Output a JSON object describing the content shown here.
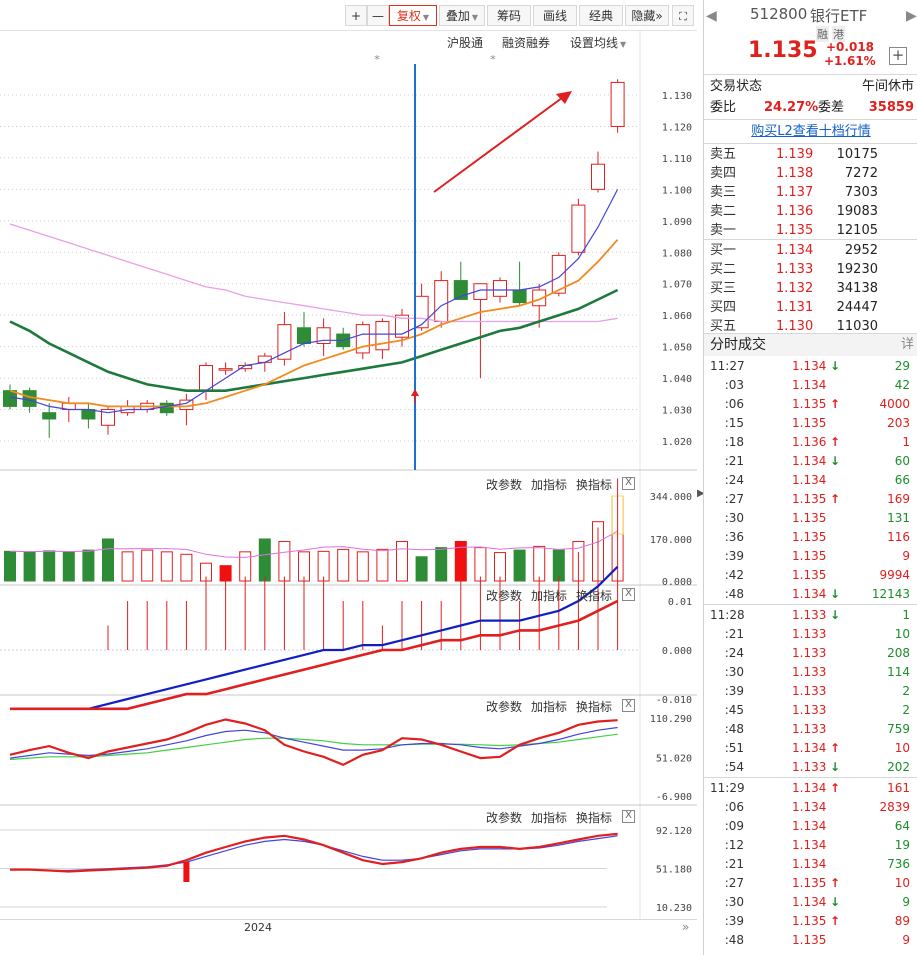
{
  "toolbar": {
    "plus": "+",
    "minus": "—",
    "fuquan": "复权",
    "diejia": "叠加",
    "chouma": "筹码",
    "huaxian": "画线",
    "jingdian": "经典",
    "yincang": "隐藏",
    "more": "»",
    "expand": "⛶"
  },
  "sublinks": {
    "hugutong": "沪股通",
    "rongzi": "融资融券",
    "setma": "设置均线"
  },
  "price_axis": [
    "1.130",
    "1.120",
    "1.110",
    "1.100",
    "1.090",
    "1.080",
    "1.070",
    "1.060",
    "1.050",
    "1.040",
    "1.030",
    "1.020"
  ],
  "vol_axis": [
    "344.000",
    "170.000",
    "0.000"
  ],
  "macd_axis": [
    "0.01",
    "0.000",
    "-0.010"
  ],
  "ind3_axis": [
    "110.290",
    "51.020",
    "-6.900"
  ],
  "ind4_axis": [
    "92.120",
    "51.180",
    "10.230"
  ],
  "panel_controls": {
    "gai": "改参数",
    "jia": "加指标",
    "huan": "换指标",
    "close": "X"
  },
  "date_label": "2024",
  "scroll_more": "»",
  "colors": {
    "up": "#e0201e",
    "down": "#2e8b36",
    "ma5": "#4444dd",
    "ma10": "#f28a1e",
    "ma20": "#1e7a3c",
    "ma60": "#e8a0e8",
    "cursor": "#1d6fd1"
  },
  "chart_data": {
    "type": "candlestick",
    "ylim": [
      1.013,
      1.138
    ],
    "candles": [
      {
        "o": 1.036,
        "h": 1.038,
        "l": 1.03,
        "c": 1.031
      },
      {
        "o": 1.036,
        "h": 1.037,
        "l": 1.029,
        "c": 1.031
      },
      {
        "o": 1.029,
        "h": 1.032,
        "l": 1.021,
        "c": 1.027
      },
      {
        "o": 1.03,
        "h": 1.034,
        "l": 1.026,
        "c": 1.032
      },
      {
        "o": 1.03,
        "h": 1.032,
        "l": 1.024,
        "c": 1.027
      },
      {
        "o": 1.025,
        "h": 1.031,
        "l": 1.022,
        "c": 1.03
      },
      {
        "o": 1.029,
        "h": 1.033,
        "l": 1.028,
        "c": 1.031
      },
      {
        "o": 1.03,
        "h": 1.033,
        "l": 1.029,
        "c": 1.032
      },
      {
        "o": 1.032,
        "h": 1.033,
        "l": 1.028,
        "c": 1.029
      },
      {
        "o": 1.03,
        "h": 1.035,
        "l": 1.025,
        "c": 1.033
      },
      {
        "o": 1.036,
        "h": 1.045,
        "l": 1.033,
        "c": 1.044
      },
      {
        "o": 1.043,
        "h": 1.045,
        "l": 1.041,
        "c": 1.043
      },
      {
        "o": 1.043,
        "h": 1.045,
        "l": 1.042,
        "c": 1.044
      },
      {
        "o": 1.045,
        "h": 1.048,
        "l": 1.042,
        "c": 1.047
      },
      {
        "o": 1.046,
        "h": 1.061,
        "l": 1.044,
        "c": 1.057
      },
      {
        "o": 1.056,
        "h": 1.061,
        "l": 1.05,
        "c": 1.051
      },
      {
        "o": 1.051,
        "h": 1.059,
        "l": 1.047,
        "c": 1.056
      },
      {
        "o": 1.054,
        "h": 1.056,
        "l": 1.049,
        "c": 1.05
      },
      {
        "o": 1.048,
        "h": 1.058,
        "l": 1.046,
        "c": 1.057
      },
      {
        "o": 1.049,
        "h": 1.059,
        "l": 1.046,
        "c": 1.058
      },
      {
        "o": 1.053,
        "h": 1.062,
        "l": 1.05,
        "c": 1.06
      },
      {
        "o": 1.056,
        "h": 1.07,
        "l": 1.055,
        "c": 1.066
      },
      {
        "o": 1.058,
        "h": 1.074,
        "l": 1.056,
        "c": 1.071
      },
      {
        "o": 1.071,
        "h": 1.077,
        "l": 1.066,
        "c": 1.065
      },
      {
        "o": 1.065,
        "h": 1.07,
        "l": 1.04,
        "c": 1.07
      },
      {
        "o": 1.066,
        "h": 1.072,
        "l": 1.064,
        "c": 1.071
      },
      {
        "o": 1.068,
        "h": 1.077,
        "l": 1.063,
        "c": 1.064
      },
      {
        "o": 1.063,
        "h": 1.07,
        "l": 1.056,
        "c": 1.068
      },
      {
        "o": 1.067,
        "h": 1.08,
        "l": 1.066,
        "c": 1.079
      },
      {
        "o": 1.08,
        "h": 1.097,
        "l": 1.079,
        "c": 1.095
      },
      {
        "o": 1.1,
        "h": 1.112,
        "l": 1.099,
        "c": 1.108
      },
      {
        "o": 1.12,
        "h": 1.135,
        "l": 1.118,
        "c": 1.134
      }
    ],
    "ma5": [
      1.034,
      1.033,
      1.031,
      1.03,
      1.03,
      1.029,
      1.03,
      1.03,
      1.031,
      1.032,
      1.036,
      1.04,
      1.044,
      1.045,
      1.048,
      1.051,
      1.052,
      1.052,
      1.054,
      1.054,
      1.054,
      1.057,
      1.063,
      1.066,
      1.068,
      1.068,
      1.068,
      1.069,
      1.072,
      1.078,
      1.088,
      1.1
    ],
    "ma10": [
      1.036,
      1.034,
      1.033,
      1.032,
      1.032,
      1.031,
      1.031,
      1.031,
      1.031,
      1.031,
      1.032,
      1.034,
      1.036,
      1.038,
      1.041,
      1.044,
      1.046,
      1.048,
      1.05,
      1.051,
      1.052,
      1.054,
      1.057,
      1.059,
      1.061,
      1.062,
      1.063,
      1.065,
      1.068,
      1.071,
      1.077,
      1.084
    ],
    "ma20": [
      1.058,
      1.055,
      1.051,
      1.048,
      1.045,
      1.042,
      1.04,
      1.038,
      1.037,
      1.036,
      1.036,
      1.036,
      1.037,
      1.038,
      1.039,
      1.04,
      1.041,
      1.042,
      1.043,
      1.044,
      1.045,
      1.047,
      1.049,
      1.051,
      1.053,
      1.055,
      1.056,
      1.058,
      1.06,
      1.062,
      1.065,
      1.068
    ],
    "ma60": [
      1.089,
      1.087,
      1.085,
      1.083,
      1.081,
      1.079,
      1.077,
      1.075,
      1.073,
      1.071,
      1.069,
      1.068,
      1.066,
      1.065,
      1.064,
      1.063,
      1.062,
      1.061,
      1.06,
      1.06,
      1.059,
      1.059,
      1.058,
      1.058,
      1.058,
      1.058,
      1.058,
      1.058,
      1.058,
      1.058,
      1.058,
      1.059
    ],
    "volume": [
      120,
      118,
      122,
      118,
      125,
      170,
      118,
      125,
      118,
      108,
      72,
      62,
      118,
      170,
      160,
      118,
      120,
      128,
      118,
      128,
      160,
      98,
      135,
      160,
      135,
      115,
      125,
      140,
      125,
      160,
      240,
      344
    ],
    "volume_up_flags": [
      0,
      0,
      0,
      0,
      0,
      0,
      1,
      1,
      1,
      1,
      1,
      2,
      1,
      0,
      1,
      1,
      1,
      1,
      1,
      1,
      1,
      0,
      0,
      2,
      1,
      1,
      0,
      1,
      0,
      1,
      1,
      1
    ],
    "macd_dif": [
      -0.012,
      -0.012,
      -0.012,
      -0.012,
      -0.012,
      -0.011,
      -0.01,
      -0.009,
      -0.008,
      -0.007,
      -0.006,
      -0.005,
      -0.004,
      -0.003,
      -0.002,
      -0.001,
      0.0,
      0.0,
      0.001,
      0.001,
      0.002,
      0.003,
      0.004,
      0.005,
      0.006,
      0.006,
      0.006,
      0.007,
      0.008,
      0.01,
      0.013,
      0.017
    ],
    "macd_dea": [
      -0.012,
      -0.012,
      -0.012,
      -0.012,
      -0.012,
      -0.012,
      -0.012,
      -0.011,
      -0.01,
      -0.009,
      -0.009,
      -0.008,
      -0.007,
      -0.006,
      -0.005,
      -0.004,
      -0.003,
      -0.002,
      -0.001,
      0.0,
      0.0,
      0.001,
      0.002,
      0.002,
      0.003,
      0.003,
      0.004,
      0.004,
      0.005,
      0.006,
      0.008,
      0.01
    ],
    "ind3_a": [
      55,
      62,
      68,
      58,
      50,
      60,
      66,
      72,
      78,
      88,
      100,
      108,
      102,
      92,
      70,
      60,
      52,
      40,
      55,
      62,
      80,
      78,
      70,
      60,
      50,
      52,
      70,
      80,
      88,
      100,
      105,
      107
    ],
    "ind3_b": [
      50,
      54,
      58,
      56,
      54,
      56,
      60,
      64,
      70,
      76,
      84,
      90,
      92,
      88,
      80,
      74,
      68,
      62,
      62,
      64,
      70,
      72,
      72,
      70,
      66,
      64,
      68,
      72,
      78,
      86,
      92,
      96
    ],
    "ind3_c": [
      48,
      50,
      52,
      52,
      52,
      54,
      56,
      58,
      62,
      66,
      70,
      74,
      78,
      80,
      80,
      78,
      76,
      72,
      70,
      70,
      70,
      71,
      71,
      71,
      70,
      69,
      70,
      72,
      74,
      78,
      82,
      86
    ],
    "ind4_a": [
      50,
      50,
      49,
      48,
      49,
      50,
      51,
      52,
      54,
      60,
      68,
      74,
      80,
      84,
      86,
      82,
      76,
      68,
      60,
      56,
      58,
      62,
      68,
      72,
      74,
      74,
      72,
      74,
      78,
      82,
      86,
      88
    ],
    "ind4_b": [
      50,
      50,
      49,
      49,
      50,
      51,
      52,
      53,
      55,
      58,
      64,
      70,
      76,
      80,
      82,
      80,
      76,
      70,
      64,
      60,
      60,
      62,
      66,
      70,
      72,
      72,
      72,
      73,
      76,
      80,
      83,
      86
    ]
  },
  "rp": {
    "code": "512800",
    "name": "银行ETF",
    "tag1": "融",
    "tag2": "港",
    "price": "1.135",
    "change": "+0.018",
    "pct": "+1.61%",
    "plus_btn": "+",
    "status_label": "交易状态",
    "status_value": "午间休市",
    "weibi_label": "委比",
    "weibi_value": "24.27%",
    "weicha_label": "委差",
    "weicha_value": "35859",
    "buy_link": "购买L2查看十档行情",
    "asks": [
      {
        "label": "卖五",
        "price": "1.139",
        "vol": "10175"
      },
      {
        "label": "卖四",
        "price": "1.138",
        "vol": "7272"
      },
      {
        "label": "卖三",
        "price": "1.137",
        "vol": "7303"
      },
      {
        "label": "卖二",
        "price": "1.136",
        "vol": "19083"
      },
      {
        "label": "卖一",
        "price": "1.135",
        "vol": "12105"
      }
    ],
    "bids": [
      {
        "label": "买一",
        "price": "1.134",
        "vol": "2952"
      },
      {
        "label": "买二",
        "price": "1.133",
        "vol": "19230"
      },
      {
        "label": "买三",
        "price": "1.132",
        "vol": "34138"
      },
      {
        "label": "买四",
        "price": "1.131",
        "vol": "24447"
      },
      {
        "label": "买五",
        "price": "1.130",
        "vol": "11030"
      }
    ],
    "trades_title": "分时成交",
    "detail": "详",
    "trades": [
      {
        "t": "11:27",
        "p": "1.134",
        "d": "down",
        "v": "29",
        "vc": "green"
      },
      {
        "t": ":03",
        "p": "1.134",
        "d": "",
        "v": "42",
        "vc": "green"
      },
      {
        "t": ":06",
        "p": "1.135",
        "d": "up",
        "v": "4000",
        "vc": "red"
      },
      {
        "t": ":15",
        "p": "1.135",
        "d": "",
        "v": "203",
        "vc": "red"
      },
      {
        "t": ":18",
        "p": "1.136",
        "d": "up",
        "v": "1",
        "vc": "red"
      },
      {
        "t": ":21",
        "p": "1.134",
        "d": "down",
        "v": "60",
        "vc": "green"
      },
      {
        "t": ":24",
        "p": "1.134",
        "d": "",
        "v": "66",
        "vc": "green"
      },
      {
        "t": ":27",
        "p": "1.135",
        "d": "up",
        "v": "169",
        "vc": "red"
      },
      {
        "t": ":30",
        "p": "1.135",
        "d": "",
        "v": "131",
        "vc": "green"
      },
      {
        "t": ":36",
        "p": "1.135",
        "d": "",
        "v": "116",
        "vc": "red"
      },
      {
        "t": ":39",
        "p": "1.135",
        "d": "",
        "v": "9",
        "vc": "red"
      },
      {
        "t": ":42",
        "p": "1.135",
        "d": "",
        "v": "9994",
        "vc": "red"
      },
      {
        "t": ":48",
        "p": "1.134",
        "d": "down",
        "v": "12143",
        "vc": "green"
      },
      {
        "t": "11:28",
        "p": "1.133",
        "d": "down",
        "v": "1",
        "vc": "green"
      },
      {
        "t": ":21",
        "p": "1.133",
        "d": "",
        "v": "10",
        "vc": "green"
      },
      {
        "t": ":24",
        "p": "1.133",
        "d": "",
        "v": "208",
        "vc": "green"
      },
      {
        "t": ":30",
        "p": "1.133",
        "d": "",
        "v": "114",
        "vc": "green"
      },
      {
        "t": ":39",
        "p": "1.133",
        "d": "",
        "v": "2",
        "vc": "green"
      },
      {
        "t": ":45",
        "p": "1.133",
        "d": "",
        "v": "2",
        "vc": "green"
      },
      {
        "t": ":48",
        "p": "1.133",
        "d": "",
        "v": "759",
        "vc": "green"
      },
      {
        "t": ":51",
        "p": "1.134",
        "d": "up",
        "v": "10",
        "vc": "red"
      },
      {
        "t": ":54",
        "p": "1.133",
        "d": "down",
        "v": "202",
        "vc": "green"
      },
      {
        "t": "11:29",
        "p": "1.134",
        "d": "up",
        "v": "161",
        "vc": "red"
      },
      {
        "t": ":06",
        "p": "1.134",
        "d": "",
        "v": "2839",
        "vc": "red"
      },
      {
        "t": ":09",
        "p": "1.134",
        "d": "",
        "v": "64",
        "vc": "green"
      },
      {
        "t": ":12",
        "p": "1.134",
        "d": "",
        "v": "19",
        "vc": "green"
      },
      {
        "t": ":21",
        "p": "1.134",
        "d": "",
        "v": "736",
        "vc": "green"
      },
      {
        "t": ":27",
        "p": "1.135",
        "d": "up",
        "v": "10",
        "vc": "red"
      },
      {
        "t": ":30",
        "p": "1.134",
        "d": "down",
        "v": "9",
        "vc": "green"
      },
      {
        "t": ":39",
        "p": "1.135",
        "d": "up",
        "v": "89",
        "vc": "red"
      },
      {
        "t": ":48",
        "p": "1.135",
        "d": "",
        "v": "9",
        "vc": "red"
      }
    ]
  }
}
